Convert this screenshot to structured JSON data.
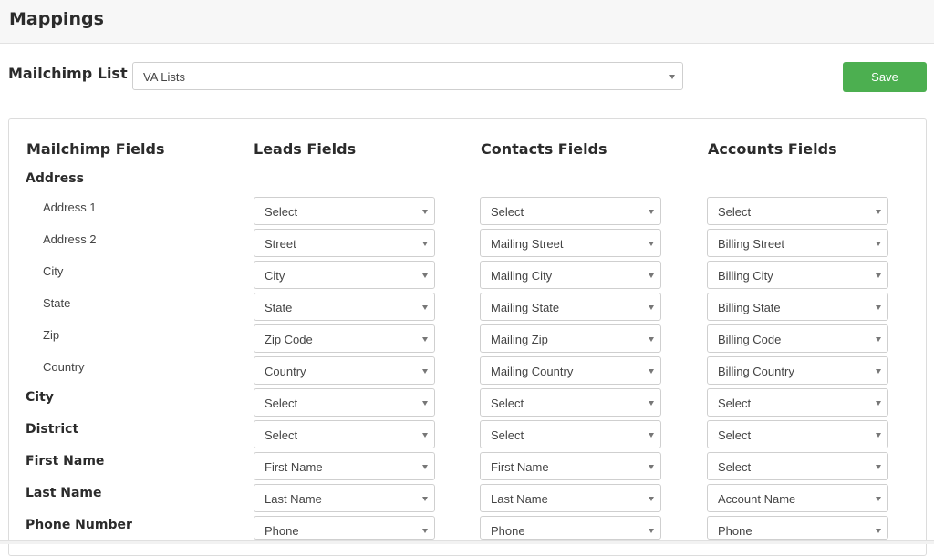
{
  "header": {
    "title": "Mappings"
  },
  "list": {
    "label": "Mailchimp List",
    "selected": "VA Lists"
  },
  "actions": {
    "save_label": "Save"
  },
  "columns": {
    "mailchimp": "Mailchimp Fields",
    "leads": "Leads Fields",
    "contacts": "Contacts Fields",
    "accounts": "Accounts Fields"
  },
  "address_group": {
    "label": "Address"
  },
  "rows": [
    {
      "label": "Address 1",
      "lead": "Select",
      "contact": "Select",
      "account": "Select"
    },
    {
      "label": "Address 2",
      "lead": "Street",
      "contact": "Mailing Street",
      "account": "Billing Street"
    },
    {
      "label": "City",
      "lead": "City",
      "contact": "Mailing City",
      "account": "Billing City"
    },
    {
      "label": "State",
      "lead": "State",
      "contact": "Mailing State",
      "account": "Billing State"
    },
    {
      "label": "Zip",
      "lead": "Zip Code",
      "contact": "Mailing Zip",
      "account": "Billing Code"
    },
    {
      "label": "Country",
      "lead": "Country",
      "contact": "Mailing Country",
      "account": "Billing Country"
    },
    {
      "label": "City",
      "lead": "Select",
      "contact": "Select",
      "account": "Select"
    },
    {
      "label": "District",
      "lead": "Select",
      "contact": "Select",
      "account": "Select"
    },
    {
      "label": "First Name",
      "lead": "First Name",
      "contact": "First Name",
      "account": "Select"
    },
    {
      "label": "Last Name",
      "lead": "Last Name",
      "contact": "Last Name",
      "account": "Account Name"
    },
    {
      "label": "Phone Number",
      "lead": "Phone",
      "contact": "Phone",
      "account": "Phone"
    }
  ]
}
